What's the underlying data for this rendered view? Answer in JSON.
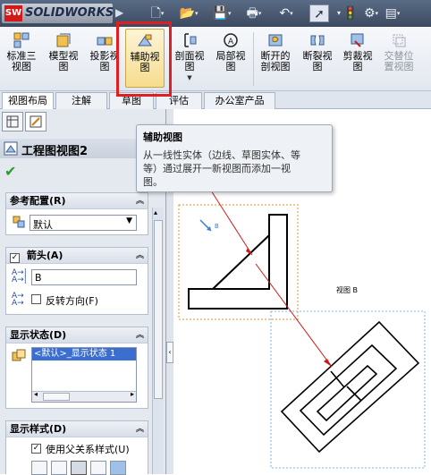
{
  "app": {
    "logo_badge": "SW",
    "logo_text": "SOLIDWORKS"
  },
  "quick_access": {
    "icons": [
      "new-document-icon",
      "open-folder-icon",
      "save-icon",
      "print-icon",
      "undo-icon",
      "select-pointer-icon",
      "traffic-light-icon",
      "options-icon",
      "properties-icon"
    ]
  },
  "ribbon": {
    "buttons": [
      {
        "id": "standard3",
        "label_lines": [
          "标准三",
          "视图"
        ]
      },
      {
        "id": "model",
        "label_lines": [
          "模型视",
          "图"
        ]
      },
      {
        "id": "projected",
        "label_lines": [
          "投影视",
          "图"
        ]
      },
      {
        "id": "auxiliary",
        "label_lines": [
          "辅助视",
          "图"
        ]
      },
      {
        "id": "section",
        "label_lines": [
          "剖面视",
          "图"
        ]
      },
      {
        "id": "detail",
        "label_lines": [
          "局部视",
          "图"
        ]
      },
      {
        "id": "broken_out",
        "label_lines": [
          "断开的",
          "剖视图"
        ]
      },
      {
        "id": "break",
        "label_lines": [
          "断裂视",
          "图"
        ]
      },
      {
        "id": "crop",
        "label_lines": [
          "剪裁视",
          "图"
        ]
      },
      {
        "id": "alternate",
        "label_lines": [
          "交替位",
          "置视图"
        ]
      }
    ]
  },
  "tabs": [
    {
      "label": "视图布局",
      "active": true
    },
    {
      "label": "注解",
      "active": false
    },
    {
      "label": "草图",
      "active": false
    },
    {
      "label": "评估",
      "active": false
    },
    {
      "label": "办公室产品",
      "active": false
    }
  ],
  "tooltip": {
    "title": "辅助视图",
    "lines": [
      "从一线性实体（边线、草图实体、等",
      "等）通过展开一新视图而添加一视",
      "图。"
    ]
  },
  "property_manager": {
    "title": "工程图视图2",
    "ref_config": {
      "header": "参考配置(R)",
      "selected": "默认"
    },
    "arrow": {
      "header": "箭头(A)",
      "label_value": "B",
      "reverse_label": "反转方向(F)"
    },
    "display_state": {
      "header": "显示状态(D)",
      "selected_item": "<默认>_显示状态 1"
    },
    "display_style": {
      "header": "显示样式(D)",
      "use_parent_label": "使用父关系样式(U)"
    }
  },
  "drawing": {
    "view_label": "视图 B",
    "arrow_letter": "B"
  },
  "colors": {
    "highlight": "#e02020",
    "arrow_line": "#d01818",
    "view_border_orange": "#d8923a",
    "view_border_blue": "#7ab6e0",
    "check_green": "#2e9a2e"
  }
}
